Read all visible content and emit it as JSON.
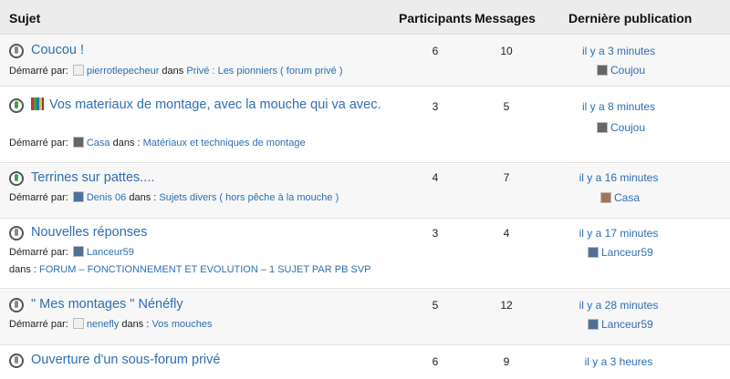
{
  "header": {
    "subject": "Sujet",
    "participants": "Participants",
    "messages": "Messages",
    "last_post": "Dernière publication"
  },
  "started_by_label": "Démarré par:",
  "in_label": "dans :",
  "in_label_short": "dans",
  "topics": [
    {
      "title": "Coucou !",
      "author": "pierrotlepecheur",
      "forum": "Privé : Les pionniers ( forum privé )",
      "participants": "6",
      "messages": "10",
      "last_time": "il y a 3 minutes",
      "last_user": "Coujou",
      "status": "gray"
    },
    {
      "title": "Vos materiaux de montage, avec la mouche qui va avec.",
      "author": "Casa",
      "forum": "Matériaux et techniques de montage",
      "participants": "3",
      "messages": "5",
      "last_time": "il y a 8 minutes",
      "last_user": "Coujou",
      "status": "green"
    },
    {
      "title": "Terrines sur pattes....",
      "author": "Denis 06",
      "forum": "Sujets divers ( hors pêche à la mouche )",
      "participants": "4",
      "messages": "7",
      "last_time": "il y a 16 minutes",
      "last_user": "Casa",
      "status": "green"
    },
    {
      "title": "Nouvelles réponses",
      "author": "Lanceur59",
      "forum": "FORUM – FONCTIONNEMENT ET EVOLUTION – 1 SUJET PAR PB SVP",
      "participants": "3",
      "messages": "4",
      "last_time": "il y a 17 minutes",
      "last_user": "Lanceur59",
      "status": "gray"
    },
    {
      "title": "\" Mes montages \" Nénéfly",
      "author": "nenefly",
      "forum": "Vos mouches",
      "participants": "5",
      "messages": "12",
      "last_time": "il y a 28 minutes",
      "last_user": "Lanceur59",
      "status": "gray"
    },
    {
      "title": "Ouverture d'un sous-forum privé",
      "participants": "6",
      "messages": "9",
      "last_time": "il y a 3 heures",
      "status": "gray"
    }
  ]
}
